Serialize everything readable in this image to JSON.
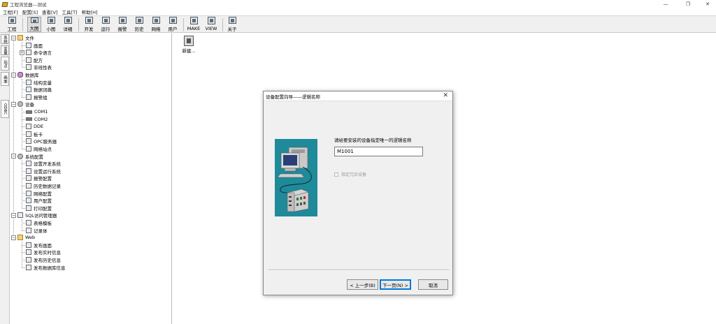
{
  "window": {
    "title": "工程浏览器---测试",
    "minimize": "—",
    "restore": "❐",
    "close": "✕"
  },
  "menu": [
    "工程[F]",
    "配置[S]",
    "查看[V]",
    "工具[T]",
    "帮助[H]"
  ],
  "toolbar": [
    "工程",
    "大图",
    "小图",
    "详细",
    "开发",
    "运行",
    "报警",
    "历史",
    "网络",
    "用户",
    "MAKE",
    "VIEW",
    "关于"
  ],
  "sidetabs": [
    "系统",
    "变量",
    "站点",
    "画面",
    "ODBC"
  ],
  "tree": [
    {
      "label": "文件",
      "level": 0,
      "icon": "folder-icon",
      "expander": "−"
    },
    {
      "label": "画面",
      "level": 1,
      "icon": "screen-icon"
    },
    {
      "label": "命令语言",
      "level": 1,
      "icon": "command-icon",
      "expander": "+"
    },
    {
      "label": "配方",
      "level": 1,
      "icon": "recipe-icon"
    },
    {
      "label": "非线性表",
      "level": 1,
      "icon": "table-icon"
    },
    {
      "label": "数据库",
      "level": 0,
      "icon": "database-icon",
      "expander": "−"
    },
    {
      "label": "结构变量",
      "level": 1,
      "icon": "struct-icon"
    },
    {
      "label": "数据词典",
      "level": 1,
      "icon": "dictionary-icon"
    },
    {
      "label": "报警组",
      "level": 1,
      "icon": "alarm-icon"
    },
    {
      "label": "设备",
      "level": 0,
      "icon": "device-icon",
      "expander": "−"
    },
    {
      "label": "COM1",
      "level": 1,
      "icon": "com-icon"
    },
    {
      "label": "COM2",
      "level": 1,
      "icon": "com-icon"
    },
    {
      "label": "DDE",
      "level": 1,
      "icon": "dde-icon"
    },
    {
      "label": "板卡",
      "level": 1,
      "icon": "board-icon"
    },
    {
      "label": "OPC服务器",
      "level": 1,
      "icon": "opc-icon"
    },
    {
      "label": "网络站点",
      "level": 1,
      "icon": "network-icon"
    },
    {
      "label": "系统配置",
      "level": 0,
      "icon": "gear-icon",
      "expander": "−"
    },
    {
      "label": "设置开发系统",
      "level": 1,
      "icon": "dev-setting-icon"
    },
    {
      "label": "设置运行系统",
      "level": 1,
      "icon": "run-setting-icon"
    },
    {
      "label": "报警配置",
      "level": 1,
      "icon": "alarm-config-icon"
    },
    {
      "label": "历史数据记录",
      "level": 1,
      "icon": "history-icon"
    },
    {
      "label": "网络配置",
      "level": 1,
      "icon": "network-config-icon"
    },
    {
      "label": "用户配置",
      "level": 1,
      "icon": "user-icon"
    },
    {
      "label": "打印配置",
      "level": 1,
      "icon": "printer-icon"
    },
    {
      "label": "SQL访问管理器",
      "level": 0,
      "icon": "sql-icon",
      "expander": "−"
    },
    {
      "label": "表格模板",
      "level": 1,
      "icon": "template-icon"
    },
    {
      "label": "记录体",
      "level": 1,
      "icon": "record-icon"
    },
    {
      "label": "Web",
      "level": 0,
      "icon": "folder-icon",
      "expander": "−"
    },
    {
      "label": "发布画面",
      "level": 1,
      "icon": "publish-screen-icon"
    },
    {
      "label": "发布实时信息",
      "level": 1,
      "icon": "publish-realtime-icon"
    },
    {
      "label": "发布历史信息",
      "level": 1,
      "icon": "publish-history-icon"
    },
    {
      "label": "发布数据库信息",
      "level": 1,
      "icon": "publish-db-icon"
    }
  ],
  "content": {
    "new_label": "新建..."
  },
  "dialog": {
    "title": "设备配置向导——逻辑名称",
    "close": "✕",
    "prompt": "请给要安装的设备指定唯一的逻辑名称",
    "logical_name": "M1001",
    "checkbox_label": "指定冗余设备",
    "back_label": "< 上一步(B)",
    "next_label": "下一页(N) >",
    "cancel_label": "取消"
  },
  "colors": {
    "picture_bg": "#1e8a9a",
    "default_button_border": "#0078d7"
  }
}
